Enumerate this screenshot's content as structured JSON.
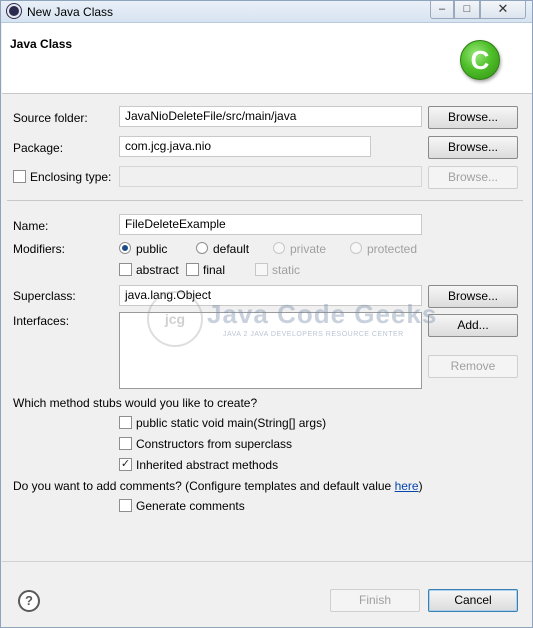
{
  "window": {
    "title": "New Java Class",
    "controls": {
      "minimize": "–",
      "maximize": "□",
      "close": "✕"
    }
  },
  "banner": {
    "title": "Java Class",
    "logo_letter": "C"
  },
  "source_folder": {
    "label": "Source folder:",
    "value": "JavaNioDeleteFile/src/main/java",
    "browse": "Browse..."
  },
  "package": {
    "label": "Package:",
    "value": "com.jcg.java.nio",
    "browse": "Browse..."
  },
  "enclosing_type": {
    "label": "Enclosing type:",
    "checked": false,
    "value": "",
    "browse": "Browse..."
  },
  "name": {
    "label": "Name:",
    "value": "FileDeleteExample"
  },
  "modifiers": {
    "label": "Modifiers:",
    "radios": [
      {
        "label": "public",
        "selected": true,
        "enabled": true
      },
      {
        "label": "default",
        "selected": false,
        "enabled": true
      },
      {
        "label": "private",
        "selected": false,
        "enabled": false
      },
      {
        "label": "protected",
        "selected": false,
        "enabled": false
      }
    ],
    "checks": [
      {
        "label": "abstract",
        "checked": false,
        "enabled": true
      },
      {
        "label": "final",
        "checked": false,
        "enabled": true
      },
      {
        "label": "static",
        "checked": false,
        "enabled": false
      }
    ]
  },
  "superclass": {
    "label": "Superclass:",
    "value": "java.lang.Object",
    "browse": "Browse..."
  },
  "interfaces": {
    "label": "Interfaces:",
    "add": "Add...",
    "remove": "Remove",
    "items": []
  },
  "watermark": {
    "logo": "jcg",
    "title": "Java Code Geeks",
    "subtitle": "JAVA 2 JAVA DEVELOPERS RESOURCE CENTER"
  },
  "stubs": {
    "question": "Which method stubs would you like to create?",
    "options": [
      {
        "label": "public static void main(String[] args)",
        "checked": false
      },
      {
        "label": "Constructors from superclass",
        "checked": false
      },
      {
        "label": "Inherited abstract methods",
        "checked": true
      }
    ]
  },
  "comments": {
    "question_prefix": "Do you want to add comments? (Configure templates and default value ",
    "link": "here",
    "question_suffix": ")",
    "option": {
      "label": "Generate comments",
      "checked": false
    }
  },
  "footer": {
    "help": "?",
    "finish": "Finish",
    "cancel": "Cancel"
  },
  "colors": {
    "accent_green": "#4fbf2a",
    "link_blue": "#0645ad",
    "radio_selected": "#1b4c8a"
  },
  "icons": {
    "app": "eclipse-icon",
    "help": "help-icon",
    "check": "checkmark-icon"
  }
}
